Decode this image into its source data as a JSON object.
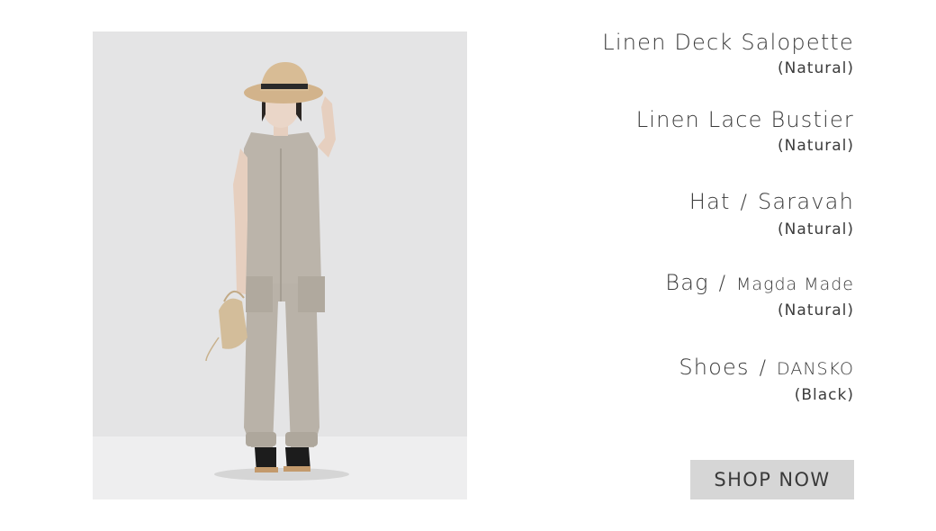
{
  "product_photo": {
    "icon": "model-in-linen-salopette-photo"
  },
  "items": [
    {
      "name": "Linen Deck Salopette",
      "brand": "",
      "color": "(Natural)"
    },
    {
      "name": "Linen Lace Bustier",
      "brand": "",
      "color": "(Natural)"
    },
    {
      "name": "Hat",
      "brand": "Saravah",
      "color": "(Natural)"
    },
    {
      "name": "Bag",
      "brand": "Magda Made",
      "color": "(Natural)"
    },
    {
      "name": "Shoes",
      "brand": "DANSKO",
      "color": "(Black)"
    }
  ],
  "separator": "/",
  "cta": {
    "label": "SHOP NOW"
  },
  "colors": {
    "text": "#3b3b3b",
    "button_bg": "#d6d6d6",
    "photo_bg": "#e6e6e6"
  }
}
